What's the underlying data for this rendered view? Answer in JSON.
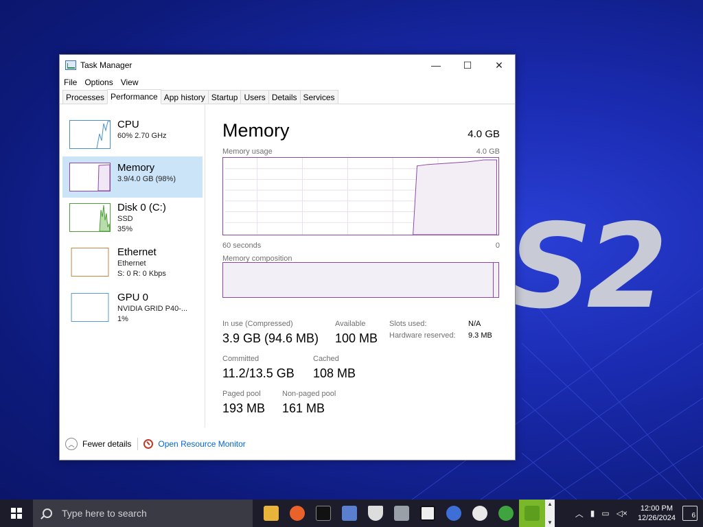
{
  "window": {
    "title": "Task Manager",
    "controls": {
      "minimize": "—",
      "maximize": "☐",
      "close": "✕"
    }
  },
  "menu": [
    "File",
    "Options",
    "View"
  ],
  "tabs": [
    "Processes",
    "Performance",
    "App history",
    "Startup",
    "Users",
    "Details",
    "Services"
  ],
  "active_tab": "Performance",
  "sidebar": {
    "items": [
      {
        "name": "CPU",
        "line1": "60%  2.70 GHz",
        "line2": "",
        "color": "#4a90c8"
      },
      {
        "name": "Memory",
        "line1": "3.9/4.0 GB (98%)",
        "line2": "",
        "color": "#8b46a6",
        "selected": true
      },
      {
        "name": "Disk 0 (C:)",
        "line1": "SSD",
        "line2": "35%",
        "color": "#4d9c3a"
      },
      {
        "name": "Ethernet",
        "line1": "Ethernet",
        "line2": "S: 0  R: 0 Kbps",
        "color": "#c07a2a"
      },
      {
        "name": "GPU 0",
        "line1": "NVIDIA GRID P40-...",
        "line2": "1%",
        "color": "#4a90c8"
      }
    ]
  },
  "memory": {
    "title": "Memory",
    "total": "4.0 GB",
    "usage_label": "Memory usage",
    "usage_max": "4.0 GB",
    "time_left": "60 seconds",
    "time_right": "0",
    "composition_label": "Memory composition",
    "stats": {
      "in_use_label": "In use (Compressed)",
      "in_use_value": "3.9 GB (94.6 MB)",
      "available_label": "Available",
      "available_value": "100 MB",
      "committed_label": "Committed",
      "committed_value": "11.2/13.5 GB",
      "cached_label": "Cached",
      "cached_value": "108 MB",
      "paged_label": "Paged pool",
      "paged_value": "193 MB",
      "nonpaged_label": "Non-paged pool",
      "nonpaged_value": "161 MB",
      "slots_label": "Slots used:",
      "slots_value": "N/A",
      "hwres_label": "Hardware reserved:",
      "hwres_value": "9.3 MB"
    },
    "accent": "#8b46a6"
  },
  "footer": {
    "fewer_details": "Fewer details",
    "open_resource_monitor": "Open Resource Monitor"
  },
  "taskbar": {
    "search_placeholder": "Type here to search",
    "time": "12:00 PM",
    "date": "12/26/2024",
    "notifications": "6"
  },
  "desktop": {
    "logo_text": "S2"
  }
}
